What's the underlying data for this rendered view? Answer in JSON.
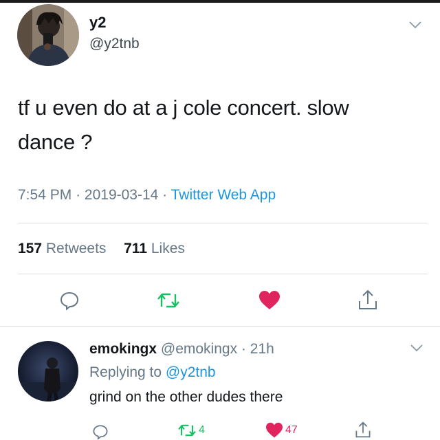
{
  "tweet": {
    "display_name": "y2",
    "handle": "@y2tnb",
    "text_line1": "tf u even do at a j cole concert. slow",
    "text_line2": "dance ?",
    "time": "7:54 PM",
    "date": "2019-03-14",
    "separator": "·",
    "source": "Twitter Web App",
    "retweet_count": "157",
    "retweet_label": "Retweets",
    "like_count": "711",
    "like_label": "Likes"
  },
  "reply": {
    "display_name": "emokingx",
    "handle": "@emokingx",
    "separator": "·",
    "time": "21h",
    "replying_label": "Replying to",
    "replying_mention": "@y2tnb",
    "text": "grind on the other dudes there",
    "retweet_count": "4",
    "like_count": "47"
  },
  "icons": {
    "reply": "speech-bubble-icon",
    "retweet": "retweet-arrows-icon",
    "like": "heart-icon",
    "share": "share-arrow-icon",
    "menu": "chevron-down-icon"
  },
  "colors": {
    "text": "#14171a",
    "muted": "#657786",
    "link": "#1b95e0",
    "retweet": "#17bf63",
    "like": "#e0245e"
  }
}
